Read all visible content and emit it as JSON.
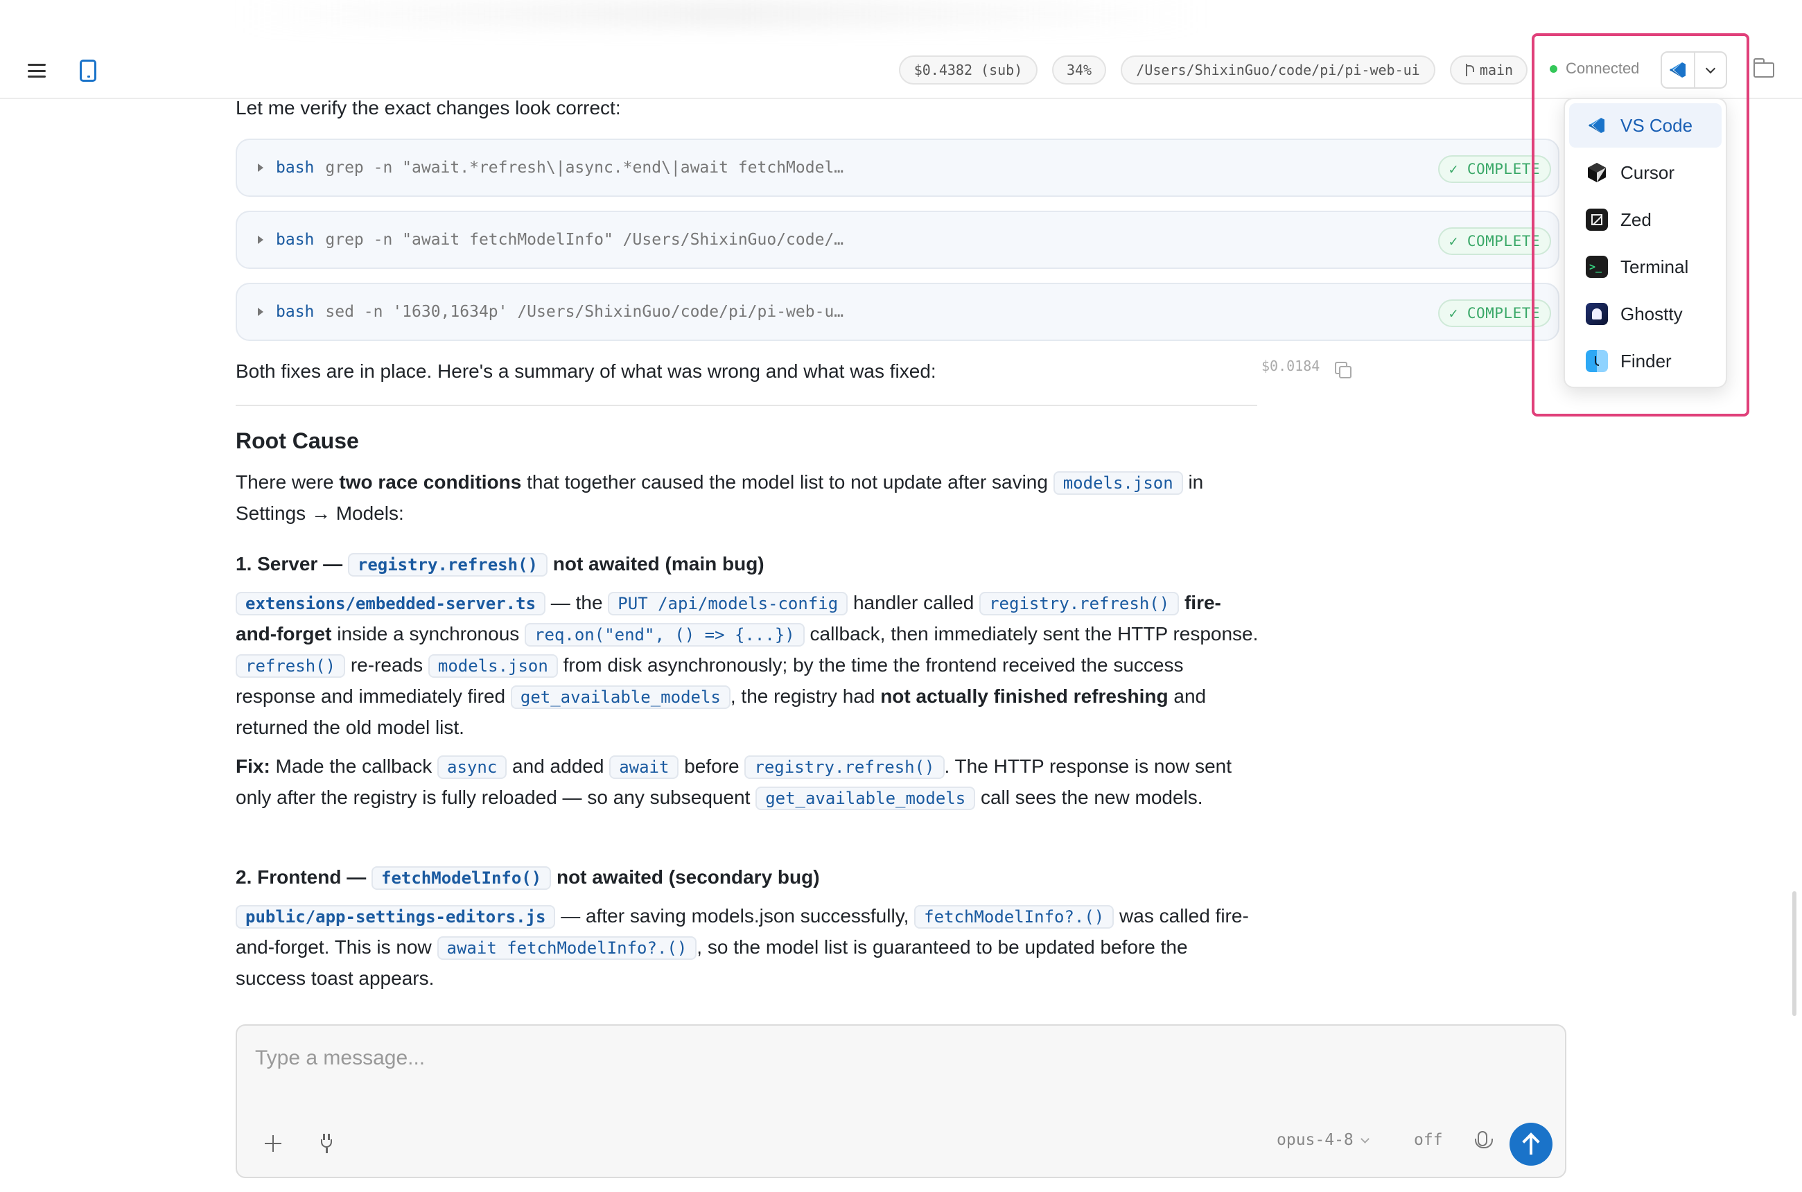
{
  "header": {
    "cost": "$0.4382 (sub)",
    "context_percent": "34%",
    "path": "/Users/ShixinGuo/code/pi/pi-web-ui",
    "branch": "main",
    "connection_status": "Connected"
  },
  "editor_menu": {
    "items": [
      {
        "label": "VS Code",
        "icon": "vscode-icon",
        "selected": true
      },
      {
        "label": "Cursor",
        "icon": "cursor-icon"
      },
      {
        "label": "Zed",
        "icon": "zed-icon"
      },
      {
        "label": "Terminal",
        "icon": "terminal-icon"
      },
      {
        "label": "Ghostty",
        "icon": "ghostty-icon"
      },
      {
        "label": "Finder",
        "icon": "finder-icon"
      }
    ]
  },
  "chat": {
    "verify_text": "Let me verify the exact changes look correct:",
    "tool_calls": [
      {
        "command": "bash",
        "args": "grep -n \"await.*refresh\\|async.*end\\|await fetchModel…",
        "status": "✓ COMPLETE"
      },
      {
        "command": "bash",
        "args": "grep -n \"await fetchModelInfo\" /Users/ShixinGuo/code/…",
        "status": "✓ COMPLETE"
      },
      {
        "command": "bash",
        "args": "sed -n '1630,1634p' /Users/ShixinGuo/code/pi/pi-web-u…",
        "status": "✓ COMPLETE"
      }
    ],
    "summary_text": "Both fixes are in place. Here's a summary of what was wrong and what was fixed:",
    "message_cost": "$0.0184",
    "root_cause_heading": "Root Cause",
    "race": {
      "t1": "There were ",
      "b1": "two race conditions",
      "t2": " that together caused the model list to not update after saving ",
      "c1": "models.json",
      "t3": " in Settings → Models:"
    },
    "server": {
      "h_num": "1. Server — ",
      "h_code": "registry.refresh()",
      "h_rest": " not awaited (main bug)",
      "c_file": "extensions/embedded-server.ts",
      "t1": " — the ",
      "c_endpoint": "PUT /api/models-config",
      "t2": " handler called ",
      "c_refresh": "registry.refresh()",
      "b_ff": " fire-and-forget",
      "t3": " inside a synchronous ",
      "c_req": "req.on(\"end\", () => {...})",
      "t4": " callback, then immediately sent the HTTP response. ",
      "c_refresh2": "refresh()",
      "t5": " re-reads ",
      "c_models": "models.json",
      "t6": " from disk asynchronously; by the time the frontend received the success response and immediately fired ",
      "c_gam": "get_available_models",
      "t7": ", the registry had ",
      "b_nf": "not actually finished refreshing",
      "t8": " and returned the old model list."
    },
    "fix": {
      "label": "Fix:",
      "t1": " Made the callback ",
      "c_async": "async",
      "t2": " and added ",
      "c_await": "await",
      "t3": " before ",
      "c_refresh": "registry.refresh()",
      "t4": ". The HTTP response is now sent only after the registry is fully reloaded — so any subsequent ",
      "c_gam": "get_available_models",
      "t5": " call sees the new models."
    },
    "frontend": {
      "h_num": "2. Frontend — ",
      "h_code": "fetchModelInfo()",
      "h_rest": " not awaited (secondary bug)",
      "c_file": "public/app-settings-editors.js",
      "t1": " — after saving models.json successfully, ",
      "c_fmi": "fetchModelInfo?.()",
      "t2": " was called fire-and-forget. This is now ",
      "c_await": "await fetchModelInfo?.()",
      "t3": ", so the model list is guaranteed to be updated before the success toast appears."
    }
  },
  "composer": {
    "placeholder": "Type a message...",
    "model": "opus-4-8",
    "thinking": "off"
  }
}
